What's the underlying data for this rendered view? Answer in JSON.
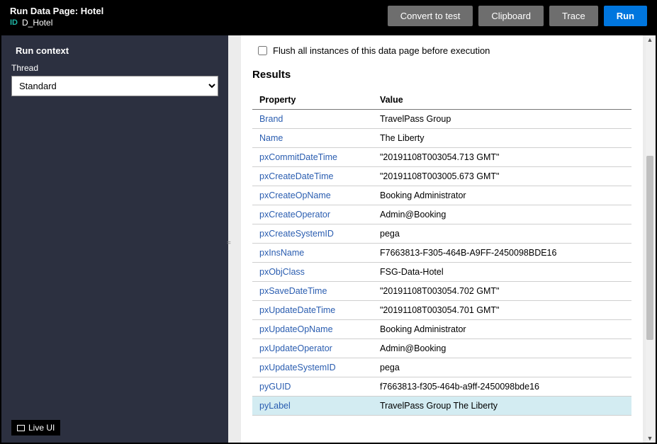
{
  "header": {
    "title_prefix": "Run Data Page:",
    "title_name": "Hotel",
    "id_label": "ID",
    "id_value": "D_Hotel",
    "buttons": {
      "convert": "Convert to test",
      "clipboard": "Clipboard",
      "trace": "Trace",
      "run": "Run"
    }
  },
  "sidebar": {
    "title": "Run context",
    "thread_label": "Thread",
    "thread_value": "Standard",
    "live_ui": "Live UI"
  },
  "content": {
    "flush_label": "Flush all instances of this data page before execution",
    "results_title": "Results",
    "columns": {
      "property": "Property",
      "value": "Value"
    },
    "rows": [
      {
        "prop": "Brand",
        "val": "TravelPass Group",
        "hl": false
      },
      {
        "prop": "Name",
        "val": "The Liberty",
        "hl": false
      },
      {
        "prop": "pxCommitDateTime",
        "val": "\"20191108T003054.713 GMT\"",
        "hl": false
      },
      {
        "prop": "pxCreateDateTime",
        "val": "\"20191108T003005.673 GMT\"",
        "hl": false
      },
      {
        "prop": "pxCreateOpName",
        "val": "Booking Administrator",
        "hl": false
      },
      {
        "prop": "pxCreateOperator",
        "val": "Admin@Booking",
        "hl": false
      },
      {
        "prop": "pxCreateSystemID",
        "val": "pega",
        "hl": false
      },
      {
        "prop": "pxInsName",
        "val": "F7663813-F305-464B-A9FF-2450098BDE16",
        "hl": false
      },
      {
        "prop": "pxObjClass",
        "val": "FSG-Data-Hotel",
        "hl": false
      },
      {
        "prop": "pxSaveDateTime",
        "val": "\"20191108T003054.702 GMT\"",
        "hl": false
      },
      {
        "prop": "pxUpdateDateTime",
        "val": "\"20191108T003054.701 GMT\"",
        "hl": false
      },
      {
        "prop": "pxUpdateOpName",
        "val": "Booking Administrator",
        "hl": false
      },
      {
        "prop": "pxUpdateOperator",
        "val": "Admin@Booking",
        "hl": false
      },
      {
        "prop": "pxUpdateSystemID",
        "val": "pega",
        "hl": false
      },
      {
        "prop": "pyGUID",
        "val": "f7663813-f305-464b-a9ff-2450098bde16",
        "hl": false
      },
      {
        "prop": "pyLabel",
        "val": "TravelPass Group The Liberty",
        "hl": true
      }
    ]
  }
}
